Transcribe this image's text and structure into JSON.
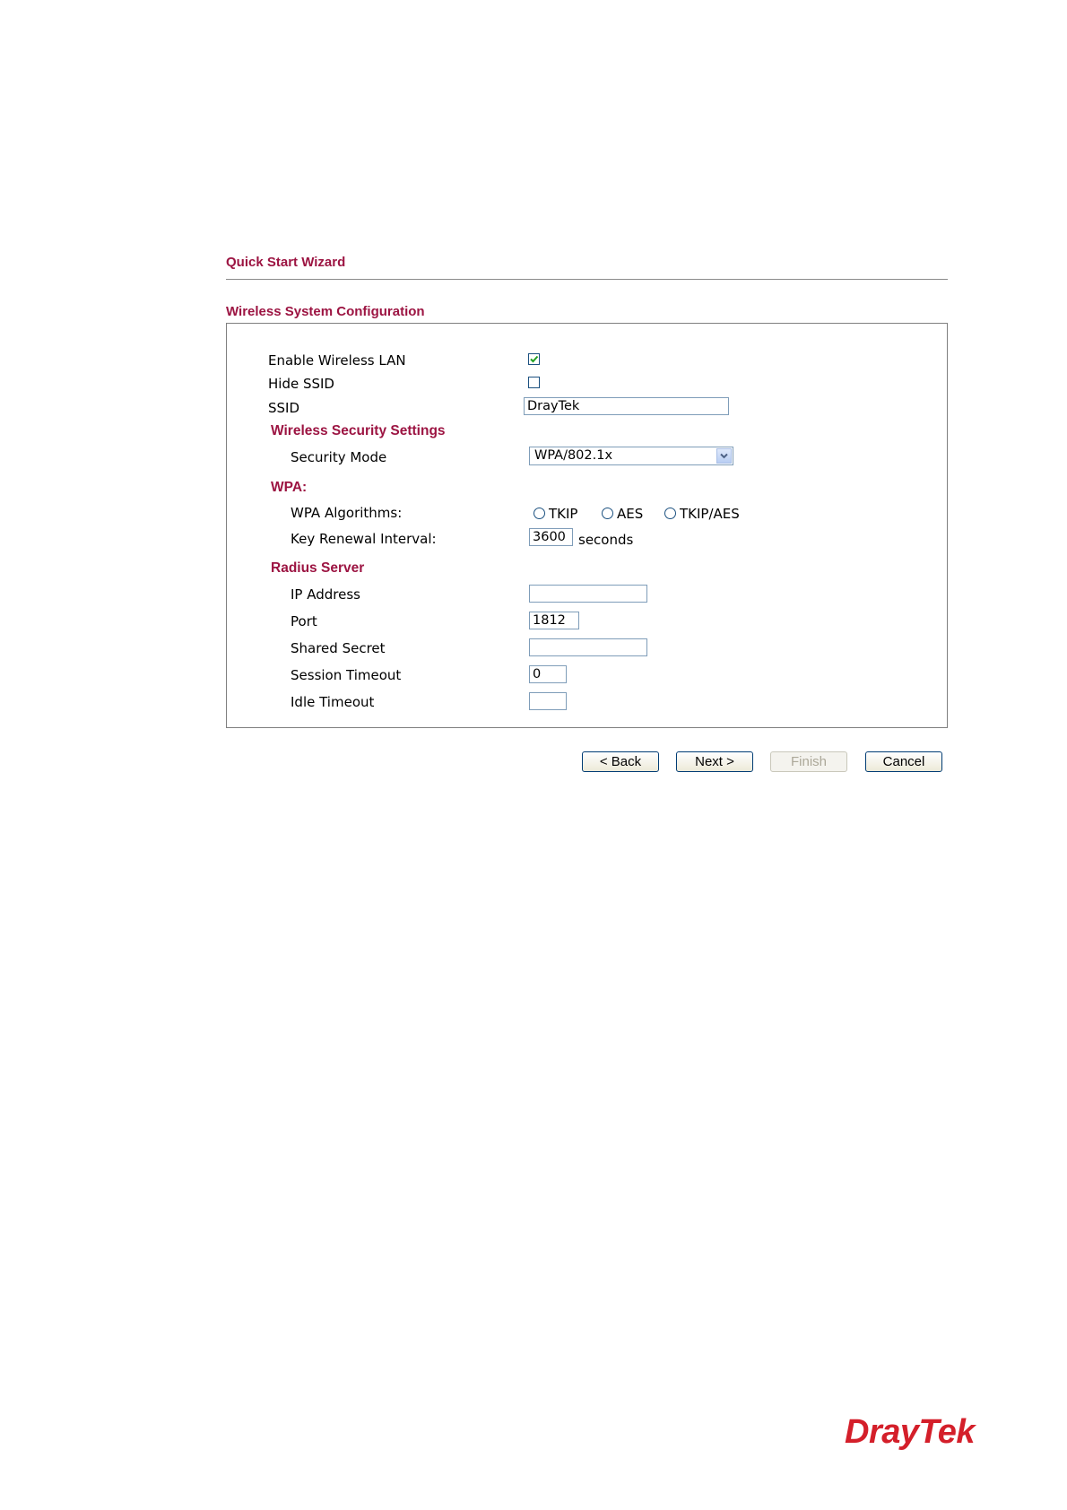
{
  "header": {
    "wizard_title": "Quick Start Wizard",
    "section_title": "Wireless System Configuration"
  },
  "form": {
    "enable_wireless_lan": {
      "label": "Enable Wireless LAN",
      "checked": true
    },
    "hide_ssid": {
      "label": "Hide SSID",
      "checked": false
    },
    "ssid": {
      "label": "SSID",
      "value": "DrayTek"
    },
    "security_heading": "Wireless Security Settings",
    "security_mode": {
      "label": "Security Mode",
      "value": "WPA/802.1x"
    },
    "wpa_heading": "WPA:",
    "wpa_algorithms": {
      "label": "WPA Algorithms:",
      "options": [
        "TKIP",
        "AES",
        "TKIP/AES"
      ]
    },
    "key_renewal": {
      "label": "Key Renewal Interval:",
      "value": "3600",
      "unit": "seconds"
    },
    "radius_heading": "Radius Server",
    "ip_address": {
      "label": "IP Address",
      "value": ""
    },
    "port": {
      "label": "Port",
      "value": "1812"
    },
    "shared_secret": {
      "label": "Shared Secret",
      "value": ""
    },
    "session_timeout": {
      "label": "Session Timeout",
      "value": "0"
    },
    "idle_timeout": {
      "label": "Idle Timeout",
      "value": ""
    }
  },
  "buttons": {
    "back": "< Back",
    "next": "Next >",
    "finish": "Finish",
    "cancel": "Cancel"
  },
  "logo": {
    "part1": "Dray",
    "part2": "Tek",
    "color": "#d41f2a"
  },
  "colors": {
    "heading": "#9c1442",
    "check": "#21a121"
  }
}
